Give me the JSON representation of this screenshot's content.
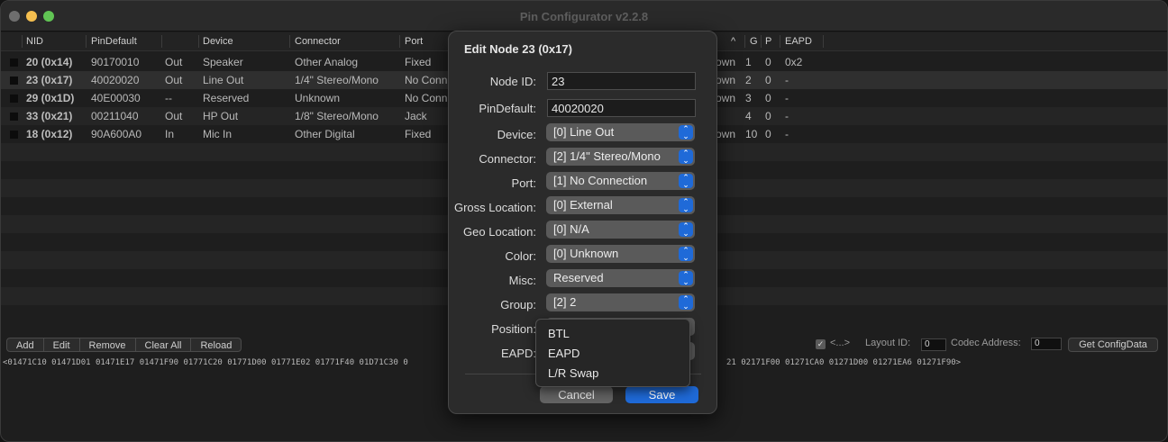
{
  "window": {
    "title": "Pin Configurator v2.2.8"
  },
  "columns": {
    "nid": "NID",
    "pindefault": "PinDefault",
    "device": "Device",
    "connector": "Connector",
    "port": "Port",
    "sort_arrow": "^",
    "g": "G",
    "p": "P",
    "eapd": "EAPD"
  },
  "rows": [
    {
      "nid": "20 (0x14)",
      "pindefault": "90170010",
      "dir": "Out",
      "device": "Speaker",
      "connector": "Other Analog",
      "port": "Fixed",
      "loc": "own",
      "g": "1",
      "p": "0",
      "eapd": "0x2"
    },
    {
      "nid": "23 (0x17)",
      "pindefault": "40020020",
      "dir": "Out",
      "device": "Line Out",
      "connector": "1/4\" Stereo/Mono",
      "port": "No Conn",
      "loc": "own",
      "g": "2",
      "p": "0",
      "eapd": "-"
    },
    {
      "nid": "29 (0x1D)",
      "pindefault": "40E00030",
      "dir": "--",
      "device": "Reserved",
      "connector": "Unknown",
      "port": "No Conn",
      "loc": "own",
      "g": "3",
      "p": "0",
      "eapd": "-"
    },
    {
      "nid": "33 (0x21)",
      "pindefault": "00211040",
      "dir": "Out",
      "device": "HP Out",
      "connector": "1/8\" Stereo/Mono",
      "port": "Jack",
      "loc": "",
      "g": "4",
      "p": "0",
      "eapd": "-"
    },
    {
      "nid": "18 (0x12)",
      "pindefault": "90A600A0",
      "dir": "In",
      "device": "Mic In",
      "connector": "Other Digital",
      "port": "Fixed",
      "loc": "own",
      "g": "10",
      "p": "0",
      "eapd": "-"
    }
  ],
  "toolbar": {
    "add": "Add",
    "edit": "Edit",
    "remove": "Remove",
    "clear_all": "Clear All",
    "reload": "Reload",
    "arrows_label": "<...>",
    "layout_id_label": "Layout ID:",
    "layout_id_value": "0",
    "codec_address_label": "Codec Address:",
    "codec_address_value": "0",
    "get_config": "Get ConfigData"
  },
  "hex": {
    "left": "<01471C10 01471D01 01471E17 01471F90 01771C20 01771D00 01771E02 01771F40 01D71C30 0",
    "right": "21 02171F00 01271CA0 01271D00 01271EA6 01271F90>"
  },
  "dialog": {
    "title": "Edit Node 23 (0x17)",
    "node_id_label": "Node ID:",
    "node_id_value": "23",
    "pindefault_label": "PinDefault:",
    "pindefault_value": "40020020",
    "device_label": "Device:",
    "device_value": "[0] Line Out",
    "connector_label": "Connector:",
    "connector_value": "[2] 1/4\" Stereo/Mono",
    "port_label": "Port:",
    "port_value": "[1] No Connection",
    "gross_label": "Gross Location:",
    "gross_value": "[0] External",
    "geo_label": "Geo Location:",
    "geo_value": "[0] N/A",
    "color_label": "Color:",
    "color_value": "[0] Unknown",
    "misc_label": "Misc:",
    "misc_value": "Reserved",
    "group_label": "Group:",
    "group_value": "[2] 2",
    "position_label": "Position:",
    "eapd_label": "EAPD:",
    "cancel": "Cancel",
    "save": "Save"
  },
  "menu": {
    "items": [
      "BTL",
      "EAPD",
      "L/R Swap"
    ]
  },
  "colors": {
    "accent": "#1f6ad8",
    "background": "#1e1e1e",
    "dialog": "#2b2b2b"
  }
}
